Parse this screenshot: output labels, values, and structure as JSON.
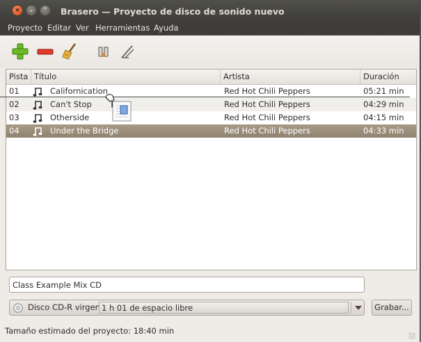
{
  "window": {
    "title": "Brasero — Proyecto de disco de sonido nuevo",
    "close_glyph": "×",
    "min_glyph": "⌄",
    "max_glyph": "⌃"
  },
  "menu": [
    "Proyecto",
    "Editar",
    "Ver",
    "Herramientas",
    "Ayuda"
  ],
  "toolbar": {
    "icons": [
      "add-icon",
      "remove-icon",
      "clear-broom-icon",
      "split-track-icon",
      "properties-wand-icon"
    ]
  },
  "table": {
    "columns": [
      "Pista",
      "Título",
      "Artista",
      "Duración"
    ],
    "rows": [
      {
        "track": "01",
        "title": "Californication",
        "artist": "Red Hot Chili Peppers",
        "duration": "05:21 min"
      },
      {
        "track": "02",
        "title": "Can't Stop",
        "artist": "Red Hot Chili Peppers",
        "duration": "04:29 min"
      },
      {
        "track": "03",
        "title": "Otherside",
        "artist": "Red Hot Chili Peppers",
        "duration": "04:15 min"
      },
      {
        "track": "04",
        "title": "Under the Bridge",
        "artist": "Red Hot Chili Peppers",
        "duration": "04:33 min"
      }
    ],
    "selected_row": 3
  },
  "project_name": "Class Example Mix CD",
  "disc": {
    "label": "Disco CD-R virgen:",
    "space_text": "1 h 01 de espacio libre"
  },
  "burn_button": "Grabar...",
  "status": "Tamaño estimado del proyecto: 18:40 min",
  "colors": {
    "titlebar": "#3e3d39",
    "selection": "#978b77",
    "accent_add": "#5fae1e",
    "accent_remove": "#d42a1c"
  }
}
